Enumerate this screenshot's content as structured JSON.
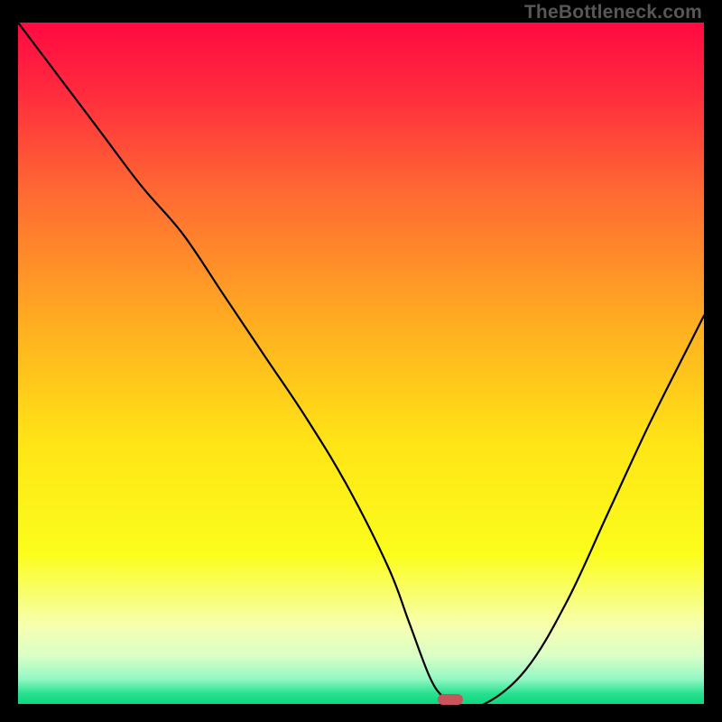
{
  "watermark": "TheBottleneck.com",
  "colors": {
    "gradient_stops": [
      {
        "pos": 0.0,
        "color": "#ff0a42"
      },
      {
        "pos": 0.1,
        "color": "#ff2a3e"
      },
      {
        "pos": 0.25,
        "color": "#ff6a33"
      },
      {
        "pos": 0.45,
        "color": "#ffb020"
      },
      {
        "pos": 0.62,
        "color": "#ffe516"
      },
      {
        "pos": 0.78,
        "color": "#fbfd1c"
      },
      {
        "pos": 0.885,
        "color": "#f7ffb0"
      },
      {
        "pos": 0.93,
        "color": "#d9ffc6"
      },
      {
        "pos": 0.963,
        "color": "#94f8c4"
      },
      {
        "pos": 0.985,
        "color": "#28e08f"
      },
      {
        "pos": 1.0,
        "color": "#0bd880"
      }
    ],
    "curve": "#000000",
    "marker": "#c9545b"
  },
  "chart_data": {
    "type": "line",
    "title": "",
    "xlabel": "",
    "ylabel": "",
    "xlim": [
      0,
      100
    ],
    "ylim": [
      0,
      100
    ],
    "series": [
      {
        "name": "bottleneck-curve",
        "x": [
          0,
          6,
          12,
          18,
          24,
          30,
          36,
          42,
          48,
          54,
          57,
          60,
          62,
          64,
          68,
          74,
          80,
          86,
          92,
          98,
          100
        ],
        "y": [
          100,
          92,
          84,
          76,
          69,
          60,
          51,
          42,
          32,
          20,
          12,
          4,
          1,
          0,
          0,
          5,
          15,
          28,
          41,
          53,
          57
        ]
      }
    ],
    "marker": {
      "x": 63.0,
      "y": 0.7
    },
    "annotations": []
  }
}
